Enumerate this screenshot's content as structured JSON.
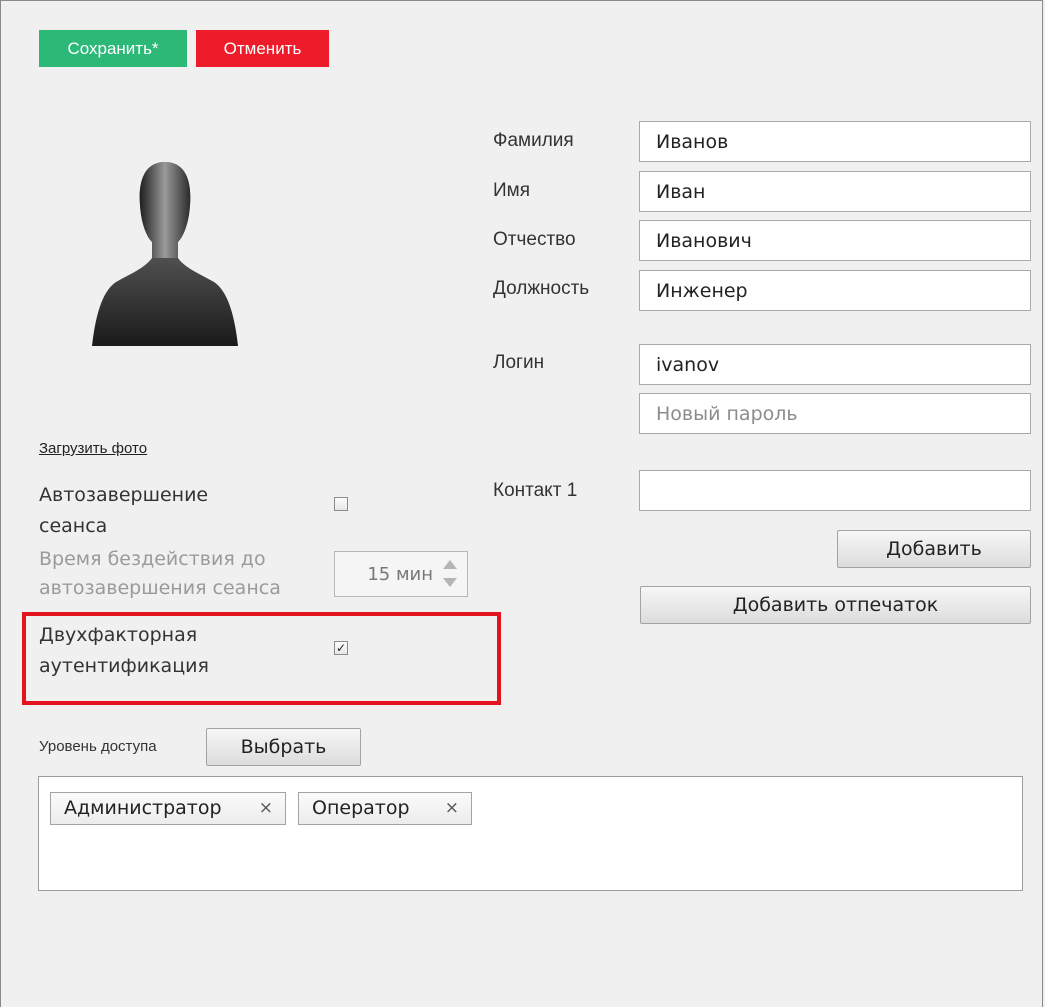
{
  "toolbar": {
    "save_label": "Сохранить*",
    "cancel_label": "Отменить"
  },
  "photo": {
    "upload_link": "Загрузить фото"
  },
  "session": {
    "auto_end_label": "Автозавершение сеанса",
    "auto_end_checked": false,
    "idle_label": "Время бездействия до автозавершения сеанса",
    "idle_value": "15 мин"
  },
  "two_factor": {
    "label": "Двухфакторная аутентификация",
    "checked": true
  },
  "access": {
    "label": "Уровень доступа",
    "choose_button": "Выбрать",
    "tags": [
      "Администратор",
      "Оператор"
    ],
    "remove_symbol": "×"
  },
  "person": {
    "last_name_label": "Фамилия",
    "last_name": "Иванов",
    "first_name_label": "Имя",
    "first_name": "Иван",
    "patronymic_label": "Отчество",
    "patronymic": "Иванович",
    "position_label": "Должность",
    "position": "Инженер"
  },
  "account": {
    "login_label": "Логин",
    "login": "ivanov",
    "password_placeholder": "Новый пароль"
  },
  "contacts": {
    "contact1_label": "Контакт 1",
    "contact1_value": "",
    "add_button": "Добавить",
    "add_fingerprint_button": "Добавить отпечаток"
  },
  "colors": {
    "save": "#2cb877",
    "cancel": "#ee1c2a",
    "highlight": "#e3141e"
  }
}
